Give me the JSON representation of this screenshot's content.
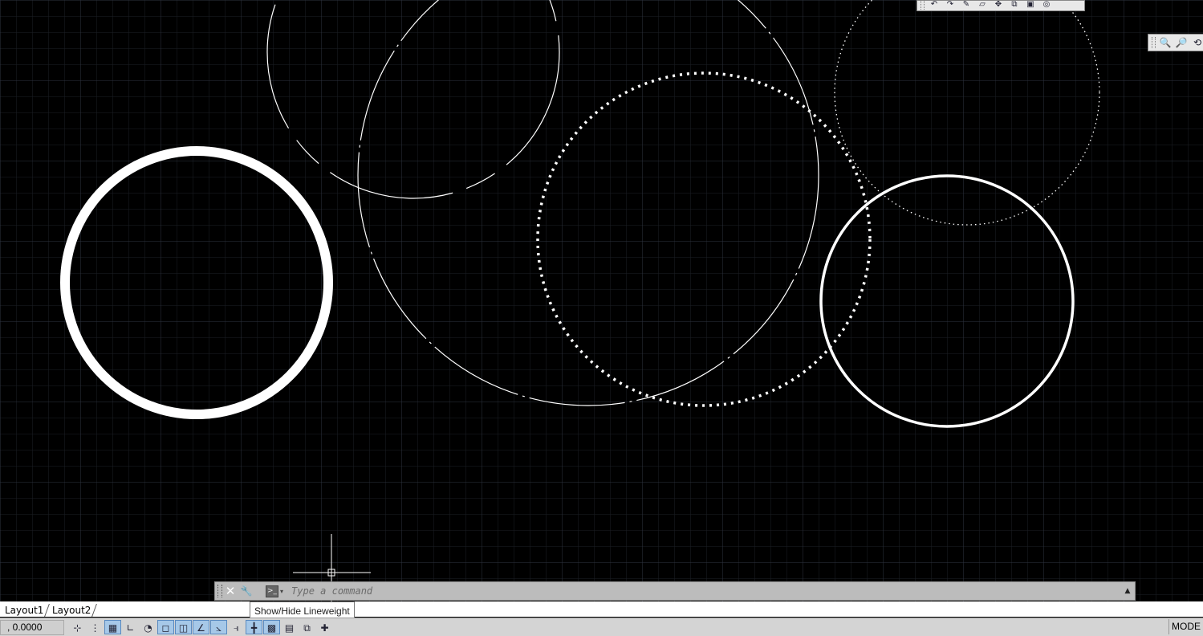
{
  "command_line": {
    "placeholder": "Type a command",
    "close_glyph": "✕",
    "customize_glyph": "🔧",
    "prompt_glyph": ">_",
    "history_glyph": "▲"
  },
  "layout_tabs": [
    {
      "label": "Layout1"
    },
    {
      "label": "Layout2"
    }
  ],
  "tooltip": {
    "text": "Show/Hide Lineweight"
  },
  "status": {
    "coordinates": ", 0.0000",
    "mode_label": "MODE",
    "icons": [
      {
        "name": "infer-constraints-icon",
        "glyph": "⊹",
        "on": false
      },
      {
        "name": "snap-mode-icon",
        "glyph": "⋮",
        "on": false
      },
      {
        "name": "grid-display-icon",
        "glyph": "▦",
        "on": true
      },
      {
        "name": "ortho-mode-icon",
        "glyph": "∟",
        "on": false
      },
      {
        "name": "polar-tracking-icon",
        "glyph": "◔",
        "on": false
      },
      {
        "name": "object-snap-icon",
        "glyph": "◻",
        "on": true
      },
      {
        "name": "3d-object-snap-icon",
        "glyph": "◫",
        "on": true
      },
      {
        "name": "object-snap-tracking-icon",
        "glyph": "∠",
        "on": true
      },
      {
        "name": "dynamic-ucs-icon",
        "glyph": "⦣",
        "on": true
      },
      {
        "name": "dynamic-input-icon",
        "glyph": "⫣",
        "on": false
      },
      {
        "name": "lineweight-icon",
        "glyph": "╋",
        "on": true
      },
      {
        "name": "transparency-icon",
        "glyph": "▩",
        "on": true
      },
      {
        "name": "quick-properties-icon",
        "glyph": "▤",
        "on": false
      },
      {
        "name": "selection-cycling-icon",
        "glyph": "⧉",
        "on": false
      },
      {
        "name": "annotation-monitor-icon",
        "glyph": "✚",
        "on": false
      }
    ]
  },
  "top_toolbar": {
    "icons": [
      {
        "name": "undo-icon",
        "glyph": "↶"
      },
      {
        "name": "redo-icon",
        "glyph": "↷"
      },
      {
        "name": "match-properties-icon",
        "glyph": "✎"
      },
      {
        "name": "erase-icon",
        "glyph": "▱"
      },
      {
        "name": "move-icon",
        "glyph": "✥"
      },
      {
        "name": "copy-icon",
        "glyph": "⧉"
      },
      {
        "name": "properties-icon",
        "glyph": "▣"
      },
      {
        "name": "layer-icon",
        "glyph": "◎"
      }
    ]
  },
  "right_toolbar": {
    "icons": [
      {
        "name": "zoom-window-icon",
        "glyph": "🔍"
      },
      {
        "name": "zoom-previous-icon",
        "glyph": "🔎"
      },
      {
        "name": "zoom-realtime-icon",
        "glyph": "⟲"
      }
    ]
  },
  "colors": {
    "background": "#000000",
    "grid_minor": "#1c1f26",
    "grid_major": "#2e3340",
    "entity": "#ffffff"
  }
}
